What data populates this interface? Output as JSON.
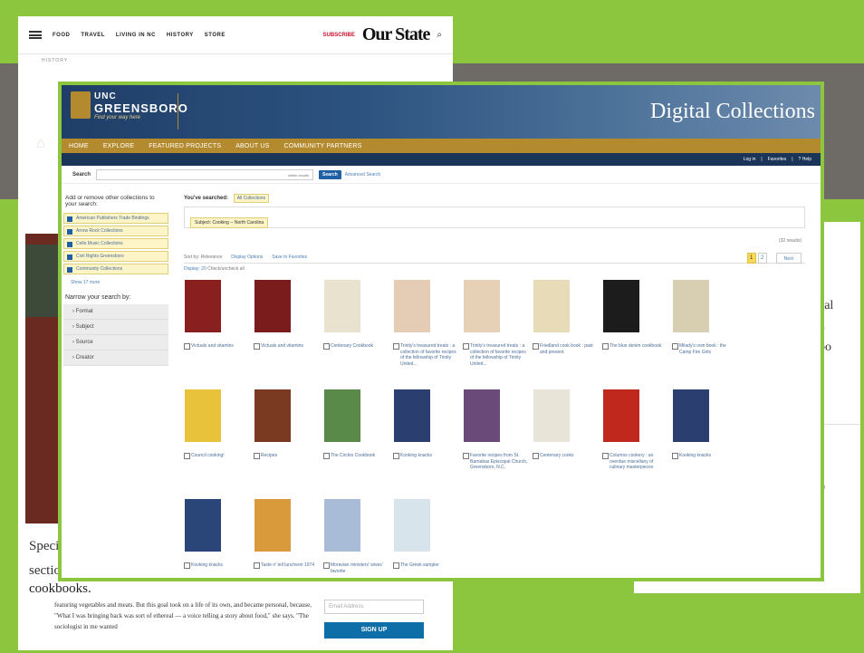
{
  "background_page": {
    "nav": [
      "FOOD",
      "TRAVEL",
      "LIVING IN NC",
      "HISTORY",
      "STORE"
    ],
    "subscribe": "SUBSCRIBE",
    "logo": "Our State",
    "history_label": "HISTORY",
    "hero_letter": "V",
    "text_lines": [
      "Speci",
      "sectio",
      "cookbooks."
    ],
    "paragraph": "featuring vegetables and meats. But this goal took on a life of its own, and became personal, because, \"What I was bringing back was sort of ethereal — a voice telling a story about food,\" she says. \"The sociologist in me wanted",
    "email_placeholder": "Email Address",
    "signup": "SIGN UP",
    "right_fragments": [
      "cal",
      "n",
      "oo",
      "o",
      "t"
    ]
  },
  "header": {
    "logo_line1": "UNC",
    "logo_line2": "GREENSBORO",
    "tagline": "Find your way here",
    "title": "Digital Collections"
  },
  "menu": [
    "HOME",
    "EXPLORE",
    "FEATURED PROJECTS",
    "ABOUT US",
    "COMMUNITY PARTNERS"
  ],
  "userbar": [
    "Log in",
    "|",
    "Favorites",
    "|",
    "? Help"
  ],
  "search": {
    "label": "Search",
    "scope": "within results",
    "button": "Search",
    "advanced": "Advanced Search"
  },
  "sidebar": {
    "title": "Add or remove other collections to your search:",
    "collections": [
      "American Publishers Trade Bindings",
      "Arrow Rock Collections",
      "Cello Music Collections",
      "Civil Rights Greensboro",
      "Community Collections"
    ],
    "show_more": "Show 17 more",
    "narrow": "Narrow your search by:",
    "facets": [
      "Format",
      "Subject",
      "Source",
      "Creator"
    ]
  },
  "main": {
    "you_searched": "You've searched:",
    "all_collections": "All Collections",
    "subject_chip": "Subject: Cooking -- North Carolina",
    "results": "(32 results)",
    "sort_by": "Sort by: Relevance",
    "display_options": "Display Options",
    "save_favorites": "Save to Favorites",
    "display": "Display: 20",
    "check_all": "Check/uncheck all",
    "pages": [
      "1",
      "2"
    ],
    "next": "Next"
  },
  "books": [
    {
      "title": "Victuals and vitamins",
      "color": "#8a1f1f"
    },
    {
      "title": "Victuals and vitamins",
      "color": "#7a1c1c"
    },
    {
      "title": "Centenary Cookbook",
      "color": "#e8e2cf"
    },
    {
      "title": "Trinity's treasured treats : a collection of favorite recipes of the fellowship of Trinity United...",
      "color": "#e4cdb4"
    },
    {
      "title": "Trinity's treasured treats : a collection of favorite recipes of the fellowship of Trinity United...",
      "color": "#e6d1b6"
    },
    {
      "title": "Friedland cook book : past and present",
      "color": "#e8dcb8"
    },
    {
      "title": "The blue denim cookbook",
      "color": "#1c1c1c"
    },
    {
      "title": "Milady's own book : the Camp Fire Girls",
      "color": "#d8cfb3"
    },
    {
      "title": "Council cooking!",
      "color": "#e8c23a"
    },
    {
      "title": "Recipes",
      "color": "#7a3a22"
    },
    {
      "title": "The Circles Cookbook",
      "color": "#5a8a4a"
    },
    {
      "title": "Kooking knacks",
      "color": "#2a3f70"
    },
    {
      "title": "Favorite recipes from St. Barnabas Episcopal Church, Greensboro, N.C.",
      "color": "#6a4a78"
    },
    {
      "title": "Centenary cooks",
      "color": "#e8e4d8"
    },
    {
      "title": "Columns cookery : an overdue miscellany of culinary masterpieces",
      "color": "#c0281e"
    },
    {
      "title": "Kooking knacks",
      "color": "#2a3f70"
    },
    {
      "title": "Kooking knacks",
      "color": "#2a4578"
    },
    {
      "title": "Taste n' tell luncheon 1974",
      "color": "#d89a3a"
    },
    {
      "title": "Moravian ministers' wives' favorite",
      "color": "#a8bcd8"
    },
    {
      "title": "The Greek sampler",
      "color": "#d8e4ec"
    }
  ]
}
